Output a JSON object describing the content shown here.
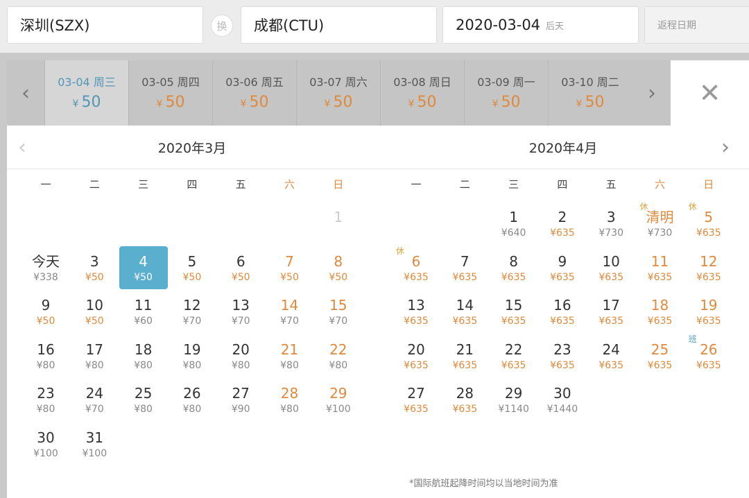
{
  "search": {
    "from": "深圳(SZX)",
    "to": "成都(CTU)",
    "swap_label": "换",
    "depart_date": "2020-03-04",
    "depart_hint": "后天",
    "return_placeholder": "返程日期"
  },
  "strip": [
    {
      "date": "03-04 周三",
      "price": "50",
      "active": true
    },
    {
      "date": "03-05 周四",
      "price": "50"
    },
    {
      "date": "03-06 周五",
      "price": "50"
    },
    {
      "date": "03-07 周六",
      "price": "50"
    },
    {
      "date": "03-08 周日",
      "price": "50"
    },
    {
      "date": "03-09 周一",
      "price": "50"
    },
    {
      "date": "03-10 周二",
      "price": "50"
    }
  ],
  "currency": "¥",
  "weekdays": [
    "一",
    "二",
    "三",
    "四",
    "五",
    "六",
    "日"
  ],
  "months": [
    {
      "title": "2020年3月",
      "days": [
        {
          "n": "1",
          "col": 6,
          "row": 0,
          "disabled": true
        },
        {
          "n": "今天",
          "col": 0,
          "row": 1,
          "price": "¥338"
        },
        {
          "n": "3",
          "col": 1,
          "row": 1,
          "price": "¥50",
          "hl": true
        },
        {
          "n": "4",
          "col": 2,
          "row": 1,
          "price": "¥50",
          "selected": true
        },
        {
          "n": "5",
          "col": 3,
          "row": 1,
          "price": "¥50",
          "hl": true
        },
        {
          "n": "6",
          "col": 4,
          "row": 1,
          "price": "¥50",
          "hl": true
        },
        {
          "n": "7",
          "col": 5,
          "row": 1,
          "price": "¥50",
          "hl": true
        },
        {
          "n": "8",
          "col": 6,
          "row": 1,
          "price": "¥50",
          "hl": true
        },
        {
          "n": "9",
          "col": 0,
          "row": 2,
          "price": "¥50",
          "hl": true
        },
        {
          "n": "10",
          "col": 1,
          "row": 2,
          "price": "¥50",
          "hl": true
        },
        {
          "n": "11",
          "col": 2,
          "row": 2,
          "price": "¥60"
        },
        {
          "n": "12",
          "col": 3,
          "row": 2,
          "price": "¥70"
        },
        {
          "n": "13",
          "col": 4,
          "row": 2,
          "price": "¥70"
        },
        {
          "n": "14",
          "col": 5,
          "row": 2,
          "price": "¥70"
        },
        {
          "n": "15",
          "col": 6,
          "row": 2,
          "price": "¥70"
        },
        {
          "n": "16",
          "col": 0,
          "row": 3,
          "price": "¥80"
        },
        {
          "n": "17",
          "col": 1,
          "row": 3,
          "price": "¥80"
        },
        {
          "n": "18",
          "col": 2,
          "row": 3,
          "price": "¥80"
        },
        {
          "n": "19",
          "col": 3,
          "row": 3,
          "price": "¥80"
        },
        {
          "n": "20",
          "col": 4,
          "row": 3,
          "price": "¥80"
        },
        {
          "n": "21",
          "col": 5,
          "row": 3,
          "price": "¥80"
        },
        {
          "n": "22",
          "col": 6,
          "row": 3,
          "price": "¥80"
        },
        {
          "n": "23",
          "col": 0,
          "row": 4,
          "price": "¥80"
        },
        {
          "n": "24",
          "col": 1,
          "row": 4,
          "price": "¥70"
        },
        {
          "n": "25",
          "col": 2,
          "row": 4,
          "price": "¥80"
        },
        {
          "n": "26",
          "col": 3,
          "row": 4,
          "price": "¥80"
        },
        {
          "n": "27",
          "col": 4,
          "row": 4,
          "price": "¥90"
        },
        {
          "n": "28",
          "col": 5,
          "row": 4,
          "price": "¥80"
        },
        {
          "n": "29",
          "col": 6,
          "row": 4,
          "price": "¥100"
        },
        {
          "n": "30",
          "col": 0,
          "row": 5,
          "price": "¥100"
        },
        {
          "n": "31",
          "col": 1,
          "row": 5,
          "price": "¥100"
        }
      ]
    },
    {
      "title": "2020年4月",
      "days": [
        {
          "n": "1",
          "col": 2,
          "row": 0,
          "price": "¥640"
        },
        {
          "n": "2",
          "col": 3,
          "row": 0,
          "price": "¥635",
          "hl": true
        },
        {
          "n": "3",
          "col": 4,
          "row": 0,
          "price": "¥730"
        },
        {
          "n": "清明",
          "col": 5,
          "row": 0,
          "price": "¥730",
          "tag": "休"
        },
        {
          "n": "5",
          "col": 6,
          "row": 0,
          "price": "¥635",
          "hl": true,
          "tag": "休"
        },
        {
          "n": "6",
          "col": 0,
          "row": 1,
          "price": "¥635",
          "hl": true,
          "tag": "休",
          "weekend": true
        },
        {
          "n": "7",
          "col": 1,
          "row": 1,
          "price": "¥635",
          "hl": true
        },
        {
          "n": "8",
          "col": 2,
          "row": 1,
          "price": "¥635",
          "hl": true
        },
        {
          "n": "9",
          "col": 3,
          "row": 1,
          "price": "¥635",
          "hl": true
        },
        {
          "n": "10",
          "col": 4,
          "row": 1,
          "price": "¥635",
          "hl": true
        },
        {
          "n": "11",
          "col": 5,
          "row": 1,
          "price": "¥635",
          "hl": true
        },
        {
          "n": "12",
          "col": 6,
          "row": 1,
          "price": "¥635",
          "hl": true
        },
        {
          "n": "13",
          "col": 0,
          "row": 2,
          "price": "¥635",
          "hl": true
        },
        {
          "n": "14",
          "col": 1,
          "row": 2,
          "price": "¥635",
          "hl": true
        },
        {
          "n": "15",
          "col": 2,
          "row": 2,
          "price": "¥635",
          "hl": true
        },
        {
          "n": "16",
          "col": 3,
          "row": 2,
          "price": "¥635",
          "hl": true
        },
        {
          "n": "17",
          "col": 4,
          "row": 2,
          "price": "¥635",
          "hl": true
        },
        {
          "n": "18",
          "col": 5,
          "row": 2,
          "price": "¥635",
          "hl": true
        },
        {
          "n": "19",
          "col": 6,
          "row": 2,
          "price": "¥635",
          "hl": true
        },
        {
          "n": "20",
          "col": 0,
          "row": 3,
          "price": "¥635",
          "hl": true
        },
        {
          "n": "21",
          "col": 1,
          "row": 3,
          "price": "¥635",
          "hl": true
        },
        {
          "n": "22",
          "col": 2,
          "row": 3,
          "price": "¥635",
          "hl": true
        },
        {
          "n": "23",
          "col": 3,
          "row": 3,
          "price": "¥635",
          "hl": true
        },
        {
          "n": "24",
          "col": 4,
          "row": 3,
          "price": "¥635",
          "hl": true
        },
        {
          "n": "25",
          "col": 5,
          "row": 3,
          "price": "¥635",
          "hl": true
        },
        {
          "n": "26",
          "col": 6,
          "row": 3,
          "price": "¥635",
          "hl": true,
          "tag": "班",
          "tag_type": "ban"
        },
        {
          "n": "27",
          "col": 0,
          "row": 4,
          "price": "¥635",
          "hl": true
        },
        {
          "n": "28",
          "col": 1,
          "row": 4,
          "price": "¥635",
          "hl": true
        },
        {
          "n": "29",
          "col": 2,
          "row": 4,
          "price": "¥1140"
        },
        {
          "n": "30",
          "col": 3,
          "row": 4,
          "price": "¥1440"
        }
      ]
    }
  ],
  "note": "*国际航班起降时间均以当地时间为准",
  "colors": {
    "accent": "#5aafcf",
    "price_low": "#e0893a",
    "weekend": "#e0893a"
  }
}
